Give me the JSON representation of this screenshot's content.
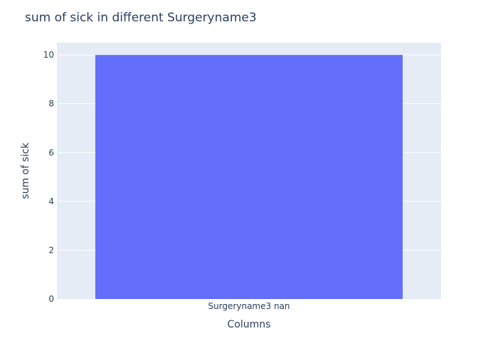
{
  "chart_data": {
    "type": "bar",
    "title": "sum of sick in different Surgeryname3",
    "xlabel": "Columns",
    "ylabel": "sum of sick",
    "categories": [
      "Surgeryname3 nan"
    ],
    "values": [
      10
    ],
    "ylim": [
      0,
      10.5
    ],
    "yticks": [
      0,
      2,
      4,
      6,
      8,
      10
    ],
    "grid": true,
    "legend": "none",
    "colors": {
      "bar": "#636efa",
      "plot_background": "#e5ecf6",
      "grid": "#ffffff",
      "text": "#2a3f5f"
    }
  }
}
